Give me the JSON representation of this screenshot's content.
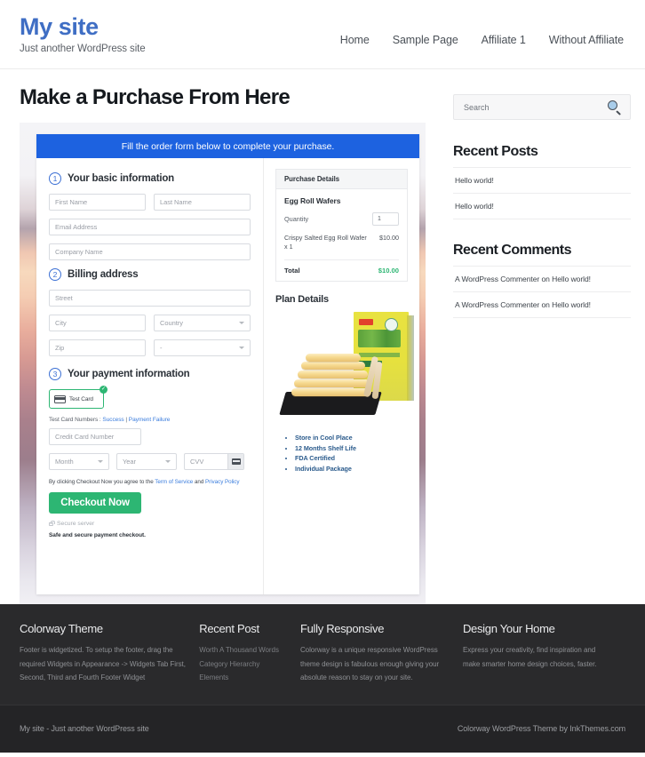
{
  "header": {
    "site_title": "My site",
    "tagline": "Just another WordPress site",
    "nav": [
      {
        "label": "Home"
      },
      {
        "label": "Sample Page"
      },
      {
        "label": "Affiliate 1"
      },
      {
        "label": "Without Affiliate"
      }
    ]
  },
  "main": {
    "page_title": "Make a Purchase From Here",
    "form": {
      "banner": "Fill the order form below to complete your purchase.",
      "step1": {
        "number": "1",
        "label": "Your basic information",
        "first_name_placeholder": "First Name",
        "last_name_placeholder": "Last Name",
        "email_placeholder": "Email Address",
        "company_placeholder": "Company Name"
      },
      "step2": {
        "number": "2",
        "label": "Billing address",
        "street_placeholder": "Street",
        "city_placeholder": "City",
        "country_placeholder": "Country",
        "zip_placeholder": "Zip",
        "state_placeholder": "-"
      },
      "step3": {
        "number": "3",
        "label": "Your payment information",
        "card_tile_label": "Test  Card",
        "card_tile_check": "✓",
        "test_cards_prefix": "Test Card Numbers : ",
        "test_cards_success": "Success",
        "test_cards_separator": " | ",
        "test_cards_failure": "Payment Failure",
        "cc_number_placeholder": "Credit Card Number",
        "month_placeholder": "Month",
        "year_placeholder": "Year",
        "cvv_placeholder": "CVV",
        "terms_prefix": "By clicking Checkout Now you agree to the ",
        "terms_link1": "Term of Service",
        "terms_middle": " and ",
        "terms_link2": "Privacy Policy",
        "checkout_label": "Checkout Now",
        "secure_server": "Secure server",
        "safe_note": "Safe and secure payment checkout."
      }
    },
    "purchase_details": {
      "heading": "Purchase Details",
      "product_name": "Egg Roll Wafers",
      "quantity_label": "Quantity",
      "quantity_value": "1",
      "line_item_name": "Crispy Salted Egg Roll Wafer x 1",
      "line_item_price": "$10.00",
      "total_label": "Total",
      "total_value": "$10.00",
      "total_color": "#2db673"
    },
    "plan_details": {
      "heading": "Plan Details",
      "features": [
        "Store in Cool Place",
        "12 Months Shelf Life",
        "FDA Certified",
        "Individual Package"
      ]
    }
  },
  "sidebar": {
    "search_placeholder": "Search",
    "widgets": [
      {
        "title": "Recent Posts",
        "items": [
          "Hello world!",
          "Hello world!"
        ]
      },
      {
        "title": "Recent Comments",
        "items": [
          "A WordPress Commenter on Hello world!",
          "A WordPress Commenter on Hello world!"
        ]
      }
    ]
  },
  "footer": {
    "widgets": [
      {
        "title": "Colorway Theme",
        "text": "Footer is widgetized. To setup the footer, drag the required Widgets in Appearance -> Widgets Tab First, Second, Third and Fourth Footer Widget"
      },
      {
        "title": "Recent Post",
        "items": [
          "Worth A Thousand Words",
          "Category Hierarchy",
          "Elements"
        ]
      },
      {
        "title": "Fully Responsive",
        "text": "Colorway is a unique responsive WordPress theme design is fabulous enough giving your absolute reason to stay on your site."
      },
      {
        "title": "Design Your Home",
        "text": "Express your creativity, find inspiration and make smarter home design choices, faster."
      }
    ],
    "bottom_left": "My site - Just another WordPress site",
    "bottom_right": "Colorway WordPress Theme by InkThemes.com"
  }
}
